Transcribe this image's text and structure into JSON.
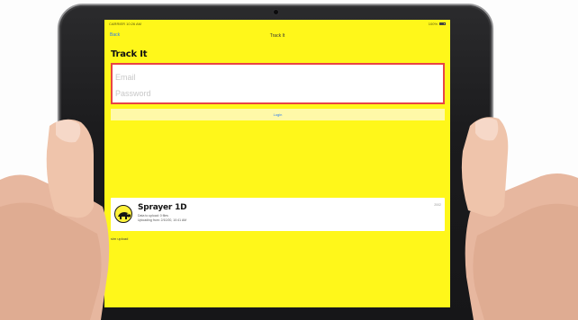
{
  "status_bar": {
    "left": "CARRIER  10:26 AM",
    "right": "100%"
  },
  "nav": {
    "back_label": "Back",
    "title": "Track It"
  },
  "app_title": "Track It",
  "login": {
    "email_placeholder": "Email",
    "password_placeholder": "Password",
    "button_label": "Login"
  },
  "device": {
    "name": "Sprayer 1D",
    "line1": "Data to upload: 0 files",
    "line2": "Uploading from: 2/10/20, 10:41 AM",
    "meta": "2002"
  },
  "upload_note": "sim upload",
  "colors": {
    "screen_background": "#fff71a",
    "login_border": "#e94545",
    "link_blue": "#2d7cf0",
    "card_background": "#ffffff"
  },
  "icons": {
    "device_avatar": "sprayer-logo-icon",
    "battery": "battery-icon"
  }
}
